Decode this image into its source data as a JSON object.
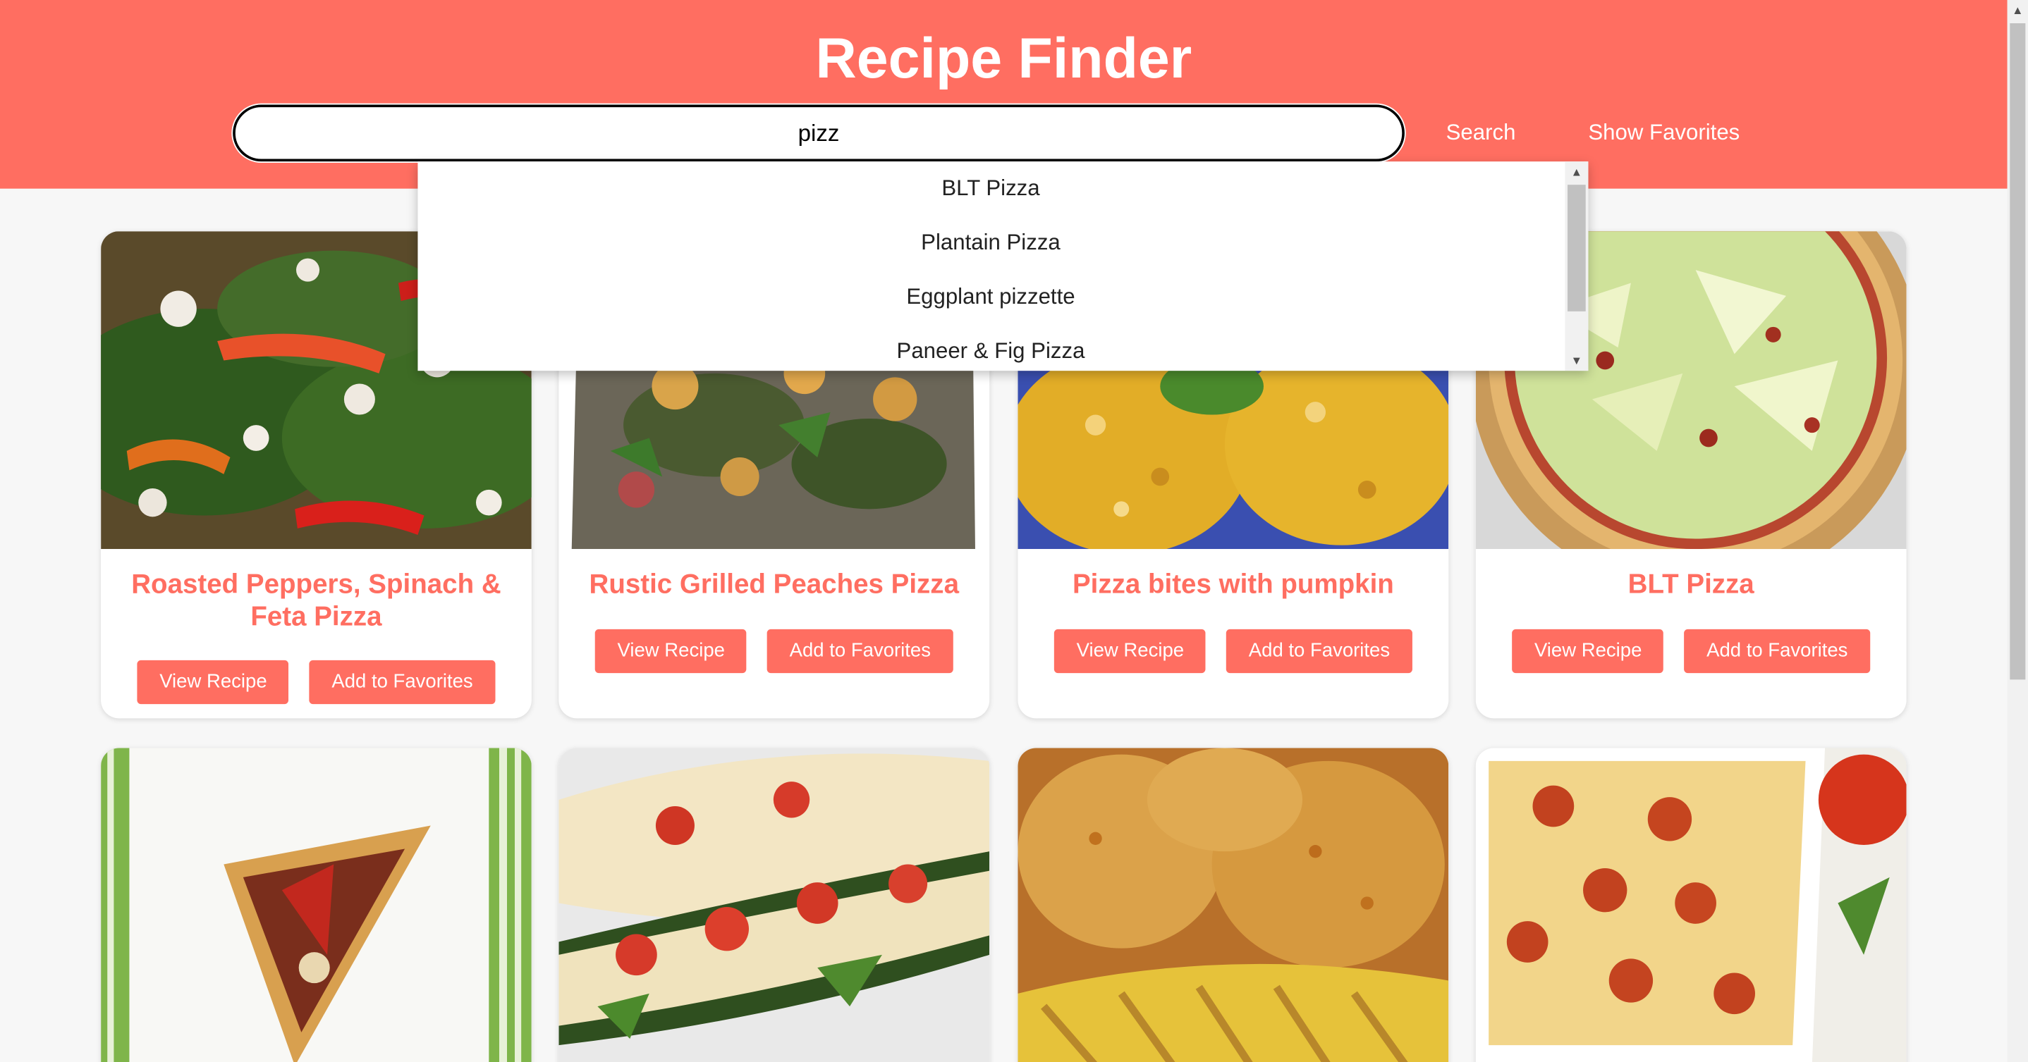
{
  "header": {
    "title": "Recipe Finder",
    "search_value": "pizz",
    "search_label": "Search",
    "favorites_label": "Show Favorites",
    "background_color": "#ff6e61"
  },
  "suggestions": [
    "BLT Pizza",
    "Plantain Pizza",
    "Eggplant pizzette",
    "Paneer & Fig Pizza"
  ],
  "cards": [
    {
      "title": "Roasted Peppers, Spinach & Feta Pizza",
      "view_label": "View Recipe",
      "fav_label": "Add to Favorites"
    },
    {
      "title": "Rustic Grilled Peaches Pizza",
      "view_label": "View Recipe",
      "fav_label": "Add to Favorites"
    },
    {
      "title": "Pizza bites with pumpkin",
      "view_label": "View Recipe",
      "fav_label": "Add to Favorites"
    },
    {
      "title": "BLT Pizza",
      "view_label": "View Recipe",
      "fav_label": "Add to Favorites"
    }
  ],
  "accent_color": "#ff6e61"
}
